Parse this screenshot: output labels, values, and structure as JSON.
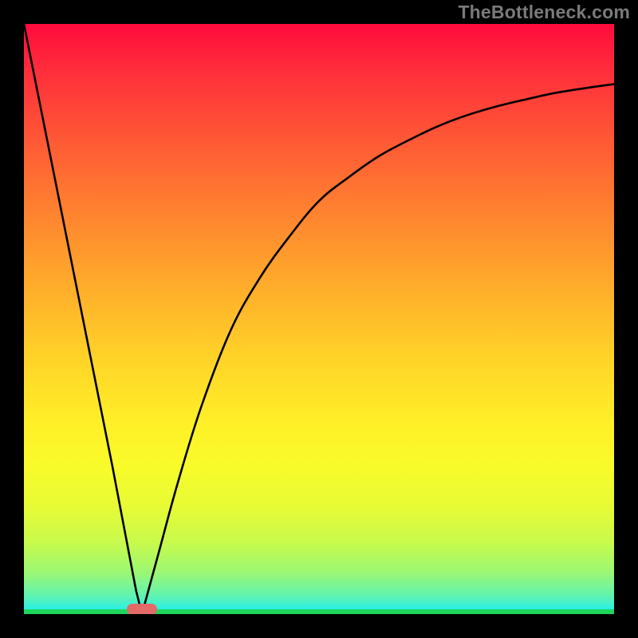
{
  "watermark": "TheBottleneck.com",
  "chart_data": {
    "type": "line",
    "title": "",
    "xlabel": "",
    "ylabel": "",
    "xlim": [
      0,
      100
    ],
    "ylim": [
      0,
      100
    ],
    "grid": false,
    "legend": false,
    "series": [
      {
        "name": "left-branch",
        "x": [
          0,
          5,
          10,
          15,
          19,
          20
        ],
        "values": [
          100,
          75,
          50,
          25,
          4,
          0
        ]
      },
      {
        "name": "right-branch",
        "x": [
          20,
          23,
          26,
          30,
          35,
          40,
          45,
          50,
          55,
          60,
          65,
          70,
          75,
          80,
          85,
          90,
          95,
          100
        ],
        "values": [
          0,
          11,
          22,
          35,
          48,
          57,
          64,
          70,
          74,
          77.5,
          80.2,
          82.6,
          84.5,
          86,
          87.2,
          88.3,
          89.1,
          89.8
        ]
      }
    ],
    "marker": {
      "x": 20,
      "y": 0,
      "label": ""
    },
    "background": {
      "type": "vertical-gradient",
      "stops": [
        {
          "pos": 0.0,
          "color": "#ff0b3d"
        },
        {
          "pos": 0.5,
          "color": "#ffb82a"
        },
        {
          "pos": 0.75,
          "color": "#f8fb2a"
        },
        {
          "pos": 0.97,
          "color": "#5ef3b2"
        },
        {
          "pos": 1.0,
          "color": "#19e7d8"
        }
      ],
      "bottom_band_color": "#1fd65c"
    }
  }
}
